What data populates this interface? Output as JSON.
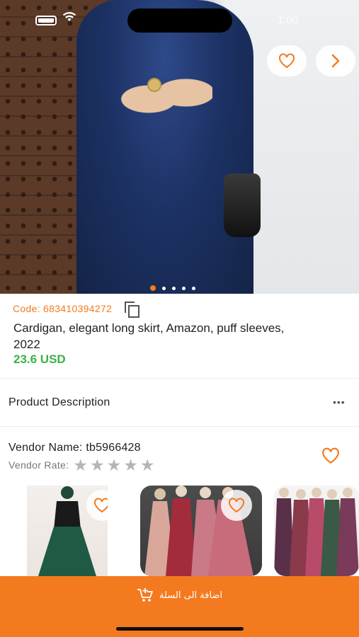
{
  "status_bar": {
    "time": "1:00"
  },
  "product": {
    "code": "Code: 683410394272",
    "title": "Cardigan, elegant long skirt, Amazon, puff sleeves, 2022",
    "price": "23.6 USD",
    "image_pages": 5,
    "image_active_index": 0
  },
  "sections": {
    "description_label": "Product Description",
    "more_icon": "ellipsis-icon"
  },
  "vendor": {
    "name": "Vendor Name: tb5966428",
    "rate_label": "Vendor Rate:",
    "rating": 0,
    "max_rating": 5
  },
  "related_items": [
    {
      "icon": "heart-icon"
    },
    {
      "icon": "heart-icon"
    },
    {
      "icon": "heart-icon"
    }
  ],
  "cart": {
    "add_label": "اضافة الى السلة",
    "icon": "add-to-cart-icon"
  },
  "colors": {
    "accent": "#f47a1f",
    "price": "#3bb04a",
    "star_inactive": "#b5b5b5"
  }
}
